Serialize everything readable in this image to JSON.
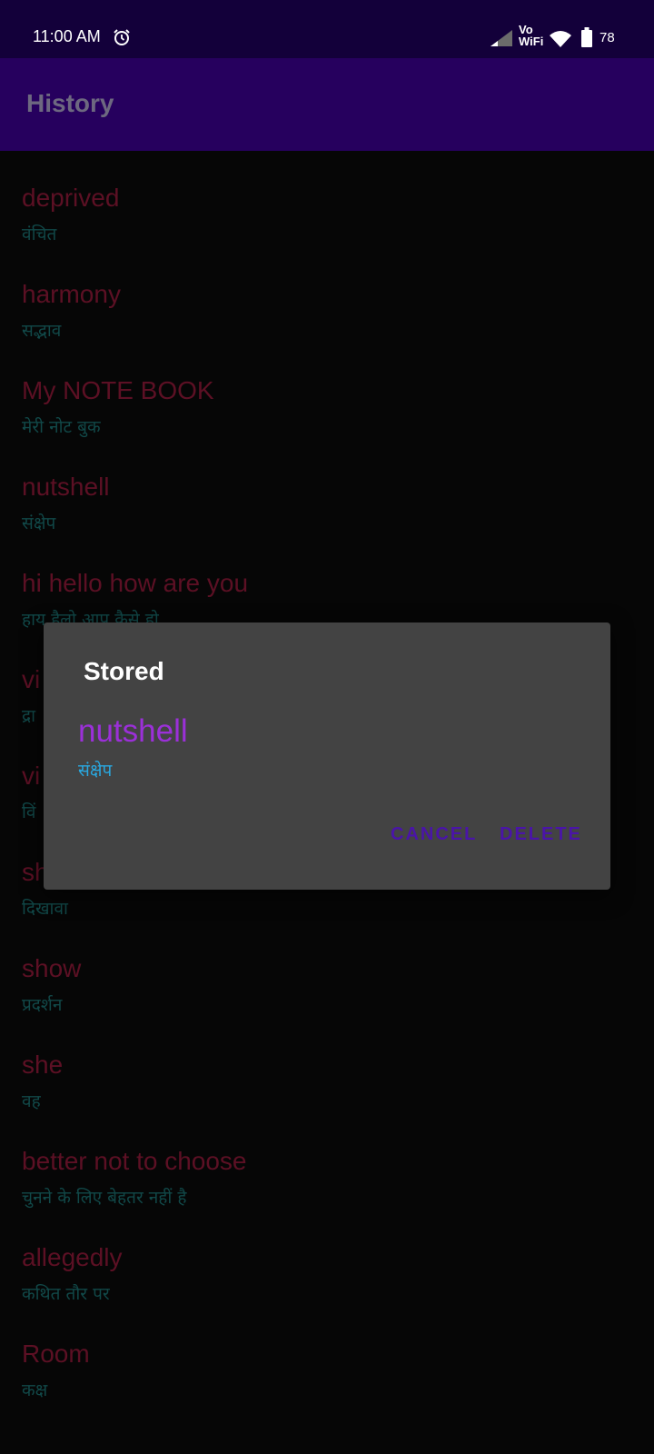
{
  "status_bar": {
    "time": "11:00 AM",
    "vo_label": "Vo",
    "wifi_label": "WiFi",
    "battery": "78",
    "icons": [
      "alarm-icon",
      "signal-icon",
      "wifi-icon",
      "battery-icon"
    ],
    "background": "#13003a"
  },
  "app_bar": {
    "title": "History",
    "background": "#26005e"
  },
  "history": {
    "word_color": "#5c1024",
    "meaning_color": "#114848",
    "items": [
      {
        "word": "deprived",
        "meaning": "वंचित"
      },
      {
        "word": "harmony",
        "meaning": "सद्भाव"
      },
      {
        "word": "My NOTE BOOK",
        "meaning": "मेरी नोट बुक"
      },
      {
        "word": "nutshell",
        "meaning": "संक्षेप"
      },
      {
        "word": "hi hello how are you",
        "meaning": "हाय हैलो आप कैसे हो"
      },
      {
        "word": "vi",
        "meaning": "द्रा"
      },
      {
        "word": "vi",
        "meaning": "विं"
      },
      {
        "word": "show off",
        "meaning": "दिखावा"
      },
      {
        "word": "show",
        "meaning": "प्रदर्शन"
      },
      {
        "word": "she",
        "meaning": "वह"
      },
      {
        "word": "better not to choose",
        "meaning": "चुनने के लिए बेहतर नहीं है"
      },
      {
        "word": "allegedly",
        "meaning": "कथित तौर पर"
      },
      {
        "word": "Room",
        "meaning": "कक्ष"
      }
    ]
  },
  "dialog": {
    "title": "Stored",
    "word": "nutshell",
    "meaning": "संक्षेप",
    "cancel_label": "CANCEL",
    "delete_label": "DELETE",
    "word_color": "#9b30d8",
    "meaning_color": "#29a8e0",
    "button_color": "#4a14a8",
    "background": "#434343"
  }
}
